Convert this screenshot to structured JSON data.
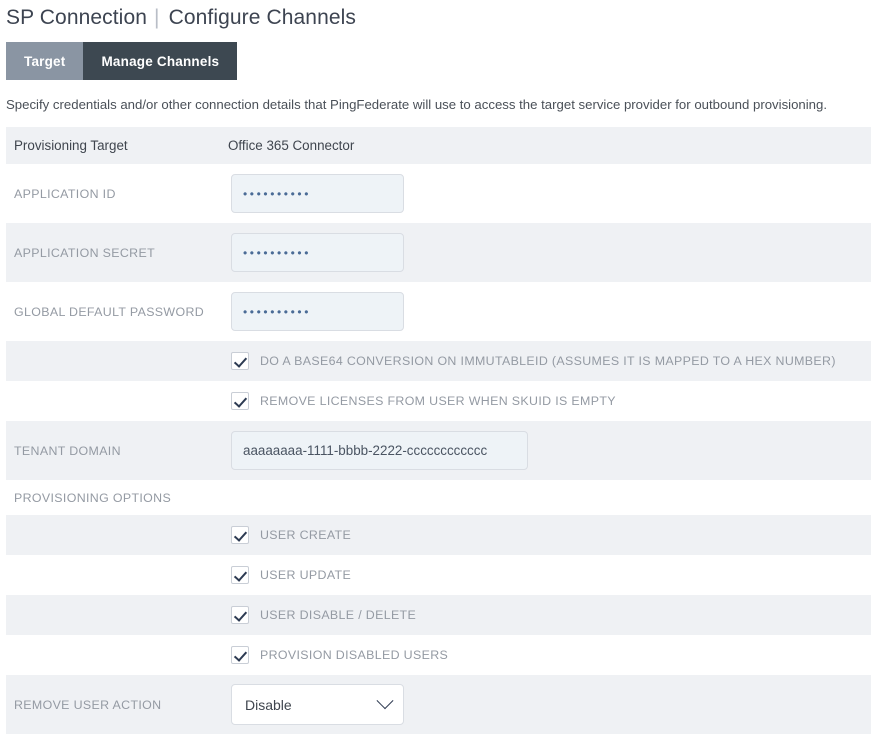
{
  "header": {
    "title_primary": "SP Connection",
    "separator": "|",
    "title_secondary": "Configure Channels"
  },
  "tabs": [
    {
      "label": "Target",
      "state": "active"
    },
    {
      "label": "Manage Channels",
      "state": "inactive"
    }
  ],
  "description": "Specify credentials and/or other connection details that PingFederate will use to access the target service provider for outbound provisioning.",
  "table": {
    "header_row": {
      "label": "Provisioning Target",
      "value": "Office 365 Connector"
    },
    "fields": {
      "application_id": {
        "label": "APPLICATION ID",
        "value": "••••••••••",
        "type": "password"
      },
      "application_secret": {
        "label": "APPLICATION SECRET",
        "value": "••••••••••",
        "type": "password"
      },
      "global_default_password": {
        "label": "GLOBAL DEFAULT PASSWORD",
        "value": "••••••••••",
        "type": "password"
      },
      "tenant_domain": {
        "label": "TENANT DOMAIN",
        "value": "aaaaaaaa-1111-bbbb-2222-cccccccccccc",
        "type": "text"
      },
      "remove_user_action": {
        "label": "REMOVE USER ACTION",
        "value": "Disable",
        "type": "select",
        "icon": "chevron-down-icon"
      }
    },
    "top_checkboxes": [
      {
        "label": "DO A BASE64 CONVERSION ON IMMUTABLEID (ASSUMES IT IS MAPPED TO A HEX NUMBER)",
        "checked": true
      },
      {
        "label": "REMOVE LICENSES FROM USER WHEN SKUID IS EMPTY",
        "checked": true
      }
    ],
    "provisioning_options": {
      "section_label": "PROVISIONING OPTIONS",
      "items": [
        {
          "label": "USER CREATE",
          "checked": true
        },
        {
          "label": "USER UPDATE",
          "checked": true
        },
        {
          "label": "USER DISABLE / DELETE",
          "checked": true
        },
        {
          "label": "PROVISION DISABLED USERS",
          "checked": true
        }
      ]
    }
  },
  "colors": {
    "tab_active": "#8a95a3",
    "tab_inactive": "#3d4851",
    "row_shade": "#eff1f4",
    "row_plain": "#ffffff",
    "label_grey": "#949aa3",
    "text_dark": "#3f454e",
    "input_fill": "#eef3f7",
    "check_navy": "#2c3a52"
  }
}
